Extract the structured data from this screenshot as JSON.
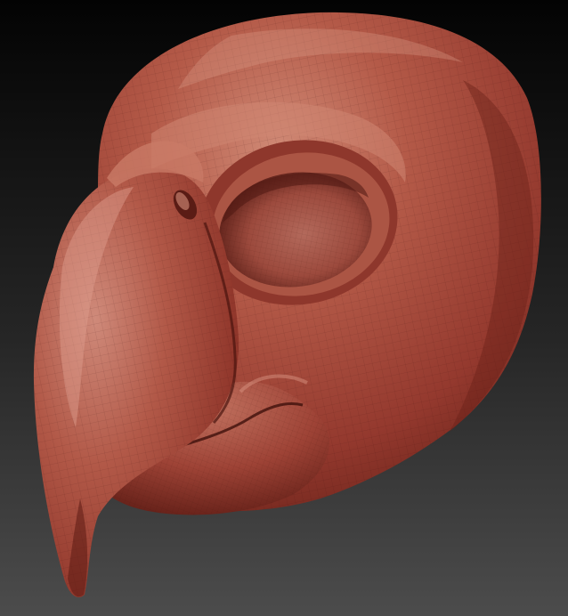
{
  "scene": {
    "subject": "sculpted-bird-head-model",
    "material_color": "#a8463a",
    "material_highlight": "#d98a78",
    "material_shadow": "#5a1c16",
    "background_top": "#050505",
    "background_bottom": "#4a4a4a",
    "wireframe_overlay": true
  }
}
